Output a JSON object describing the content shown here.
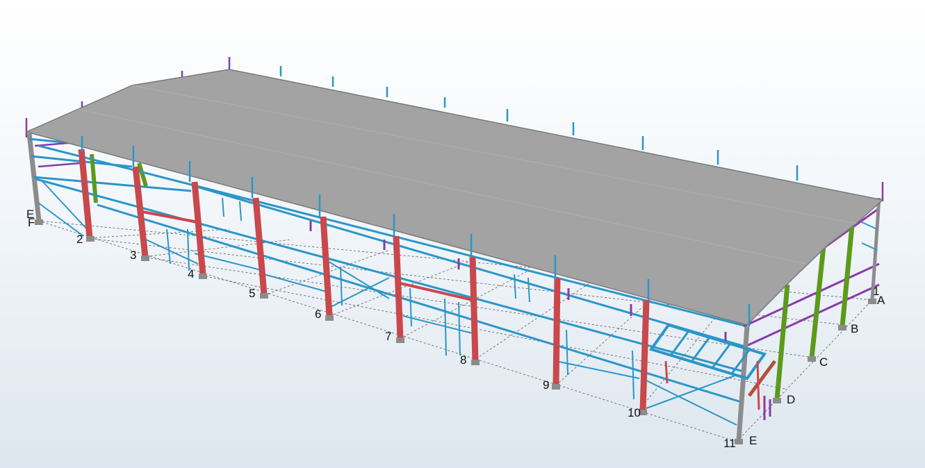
{
  "viewport": {
    "background_top": "#ffffff",
    "background_bottom": "#dde6ee"
  },
  "colors": {
    "roof": "#a3a3a3",
    "steel_blue": "#2a96c8",
    "column_red": "#c9484c",
    "column_green": "#5c9a1c",
    "bracing_purple": "#8a3aa6",
    "column_grey": "#8c8c8c",
    "beam_brown": "#b0503a"
  },
  "gridlines": {
    "numbered": [
      "2",
      "3",
      "4",
      "5",
      "6",
      "7",
      "8",
      "9",
      "10",
      "11"
    ],
    "lettered": [
      "A",
      "B",
      "C",
      "D",
      "E"
    ],
    "corner_left": [
      "E",
      "F"
    ],
    "corner_right_top": "1"
  }
}
